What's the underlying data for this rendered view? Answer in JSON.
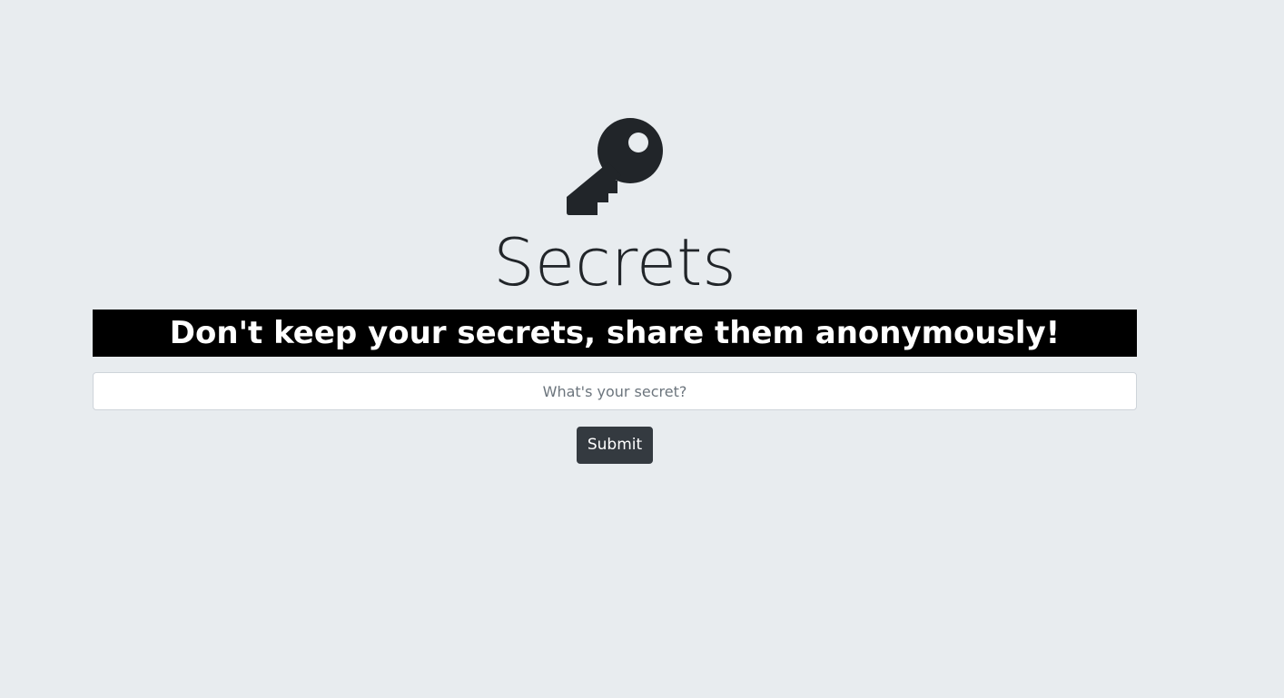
{
  "hero": {
    "icon": "key-icon",
    "title": "Secrets",
    "tagline": "Don't keep your secrets, share them anonymously!"
  },
  "form": {
    "secret_placeholder": "What's your secret?",
    "secret_value": "",
    "submit_label": "Submit"
  },
  "colors": {
    "background": "#e8ecef",
    "banner_background": "#000000",
    "banner_text": "#ffffff",
    "button_background": "#343a40",
    "icon_color": "#212529"
  }
}
